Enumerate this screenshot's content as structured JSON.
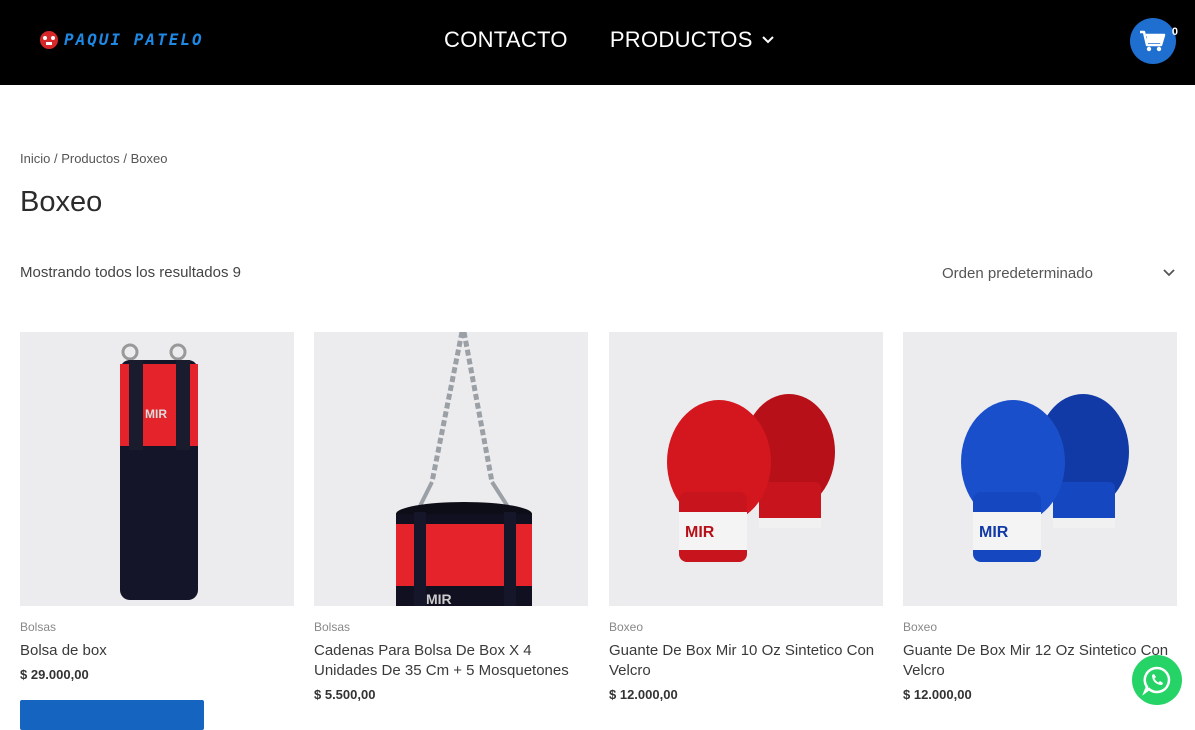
{
  "header": {
    "logo_text": "PAQUI PATELO",
    "nav": [
      {
        "label": "CONTACTO"
      },
      {
        "label": "PRODUCTOS"
      }
    ],
    "cart_count": "0"
  },
  "breadcrumb": {
    "home": "Inicio",
    "sep1": " / ",
    "section": "Productos",
    "sep2": " / ",
    "current": "Boxeo"
  },
  "page_title": "Boxeo",
  "results_text": "Mostrando todos los resultados 9",
  "orderby": {
    "selected": "Orden predeterminado"
  },
  "products": [
    {
      "category": "Bolsas",
      "title": "Bolsa de box",
      "price": "$ 29.000,00",
      "image": "punching-bag-image"
    },
    {
      "category": "Bolsas",
      "title": "Cadenas Para Bolsa De Box X 4 Unidades De 35 Cm + 5 Mosquetones",
      "price": "$ 5.500,00",
      "image": "chains-bag-image"
    },
    {
      "category": "Boxeo",
      "title": "Guante De Box Mir 10 Oz Sintetico Con Velcro",
      "price": "$ 12.000,00",
      "image": "red-gloves-image"
    },
    {
      "category": "Boxeo",
      "title": "Guante De Box Mir 12 Oz Sintetico Con Velcro",
      "price": "$ 12.000,00",
      "image": "blue-gloves-image"
    }
  ],
  "colors": {
    "accent": "#1e6fd0",
    "header_bg": "#000000",
    "whatsapp": "#25d366",
    "glove_red": "#c8141c",
    "glove_blue": "#1447c0"
  }
}
